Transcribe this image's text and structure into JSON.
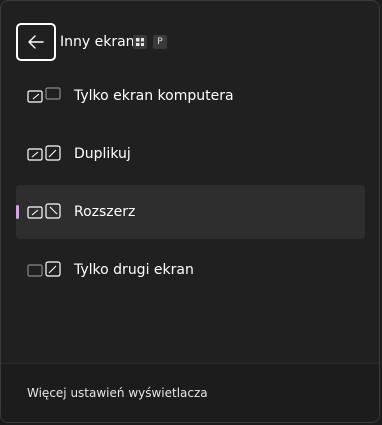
{
  "header": {
    "title": "Inny ekran",
    "shortcut_keys": [
      "win",
      "P"
    ]
  },
  "options": [
    {
      "label": "Tylko ekran komputera",
      "icon": "pc-screen-only-icon",
      "selected": false
    },
    {
      "label": "Duplikuj",
      "icon": "duplicate-icon",
      "selected": false
    },
    {
      "label": "Rozszerz",
      "icon": "extend-icon",
      "selected": true
    },
    {
      "label": "Tylko drugi ekran",
      "icon": "second-screen-only-icon",
      "selected": false
    }
  ],
  "footer": {
    "link_label": "Więcej ustawień wyświetlacza"
  },
  "colors": {
    "background": "#202020",
    "selected_bg": "#2e2e2e",
    "accent": "#d9a0e8",
    "text": "#ffffff"
  }
}
